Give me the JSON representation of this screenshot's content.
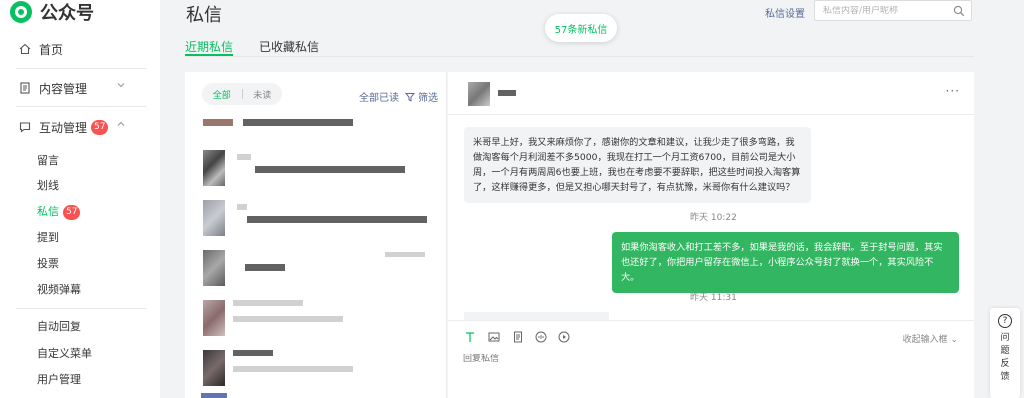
{
  "app": {
    "name": "公众号"
  },
  "sidebar": {
    "home": "首页",
    "content_mgmt": "内容管理",
    "interaction_mgmt": "互动管理",
    "interaction_badge": "57",
    "sub": {
      "comments": "留言",
      "highlights": "划线",
      "messages": "私信",
      "messages_badge": "57",
      "mentions": "提到",
      "votes": "投票",
      "danmaku": "视频弹幕"
    },
    "auto_reply": "自动回复",
    "custom_menu": "自定义菜单",
    "user_mgmt": "用户管理"
  },
  "header": {
    "title": "私信",
    "tabs": [
      "近期私信",
      "已收藏私信"
    ],
    "new_messages": "57条新私信",
    "settings": "私信设置",
    "search_placeholder": "私信内容/用户昵称"
  },
  "list": {
    "filter_all": "全部",
    "filter_unread": "未读",
    "mark_all_read": "全部已读",
    "filter": "筛选"
  },
  "chat": {
    "incoming": "米哥早上好，我又来麻烦你了，感谢你的文章和建议，让我少走了很多弯路，我做淘客每个月利润差不多5000，我现在打工一个月工资6700，目前公司是大小周，一个月有两周周6也要上班，我也在考虑要不要辞职，把这些时间投入淘客算了，这样赚得更多，但是又担心哪天封号了，有点犹豫，米哥你有什么建议吗？",
    "time1": "昨天 10:22",
    "outgoing": "如果你淘客收入和打工差不多，如果是我的话，我会辞职。至于封号问题，其实也还好了，你把用户留存在微信上，小程序公众号封了就换一个，其实风险不大。",
    "time2": "昨天 11:31",
    "collapse_input": "收起输入框",
    "reply_placeholder": "回复私信"
  },
  "feedback": {
    "label": "问题反馈"
  }
}
